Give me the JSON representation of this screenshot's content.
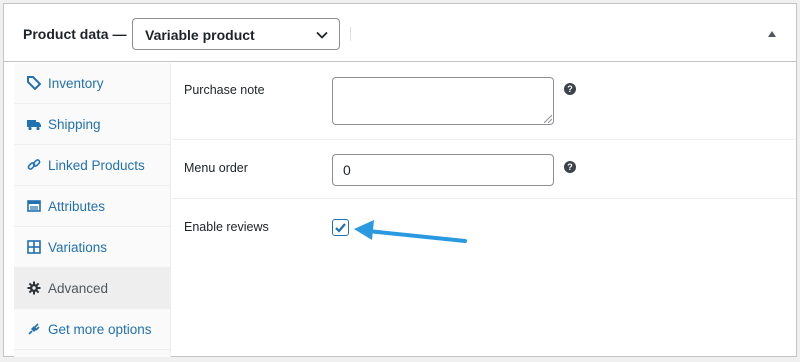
{
  "header": {
    "title": "Product data —",
    "product_type": "Variable product"
  },
  "sidebar": {
    "items": [
      {
        "label": "Inventory",
        "icon": "tag-icon"
      },
      {
        "label": "Shipping",
        "icon": "truck-icon"
      },
      {
        "label": "Linked Products",
        "icon": "link-icon"
      },
      {
        "label": "Attributes",
        "icon": "list-icon"
      },
      {
        "label": "Variations",
        "icon": "grid-icon"
      },
      {
        "label": "Advanced",
        "icon": "gear-icon",
        "active": true
      },
      {
        "label": "Get more options",
        "icon": "plug-icon"
      }
    ]
  },
  "fields": {
    "purchase_note_label": "Purchase note",
    "purchase_note_value": "",
    "menu_order_label": "Menu order",
    "menu_order_value": "0",
    "enable_reviews_label": "Enable reviews",
    "enable_reviews_checked": true,
    "help_glyph": "?"
  },
  "colors": {
    "link": "#2271b1",
    "active_tab_bg": "#eeeeee",
    "annotation_arrow": "#2a9ae0"
  }
}
